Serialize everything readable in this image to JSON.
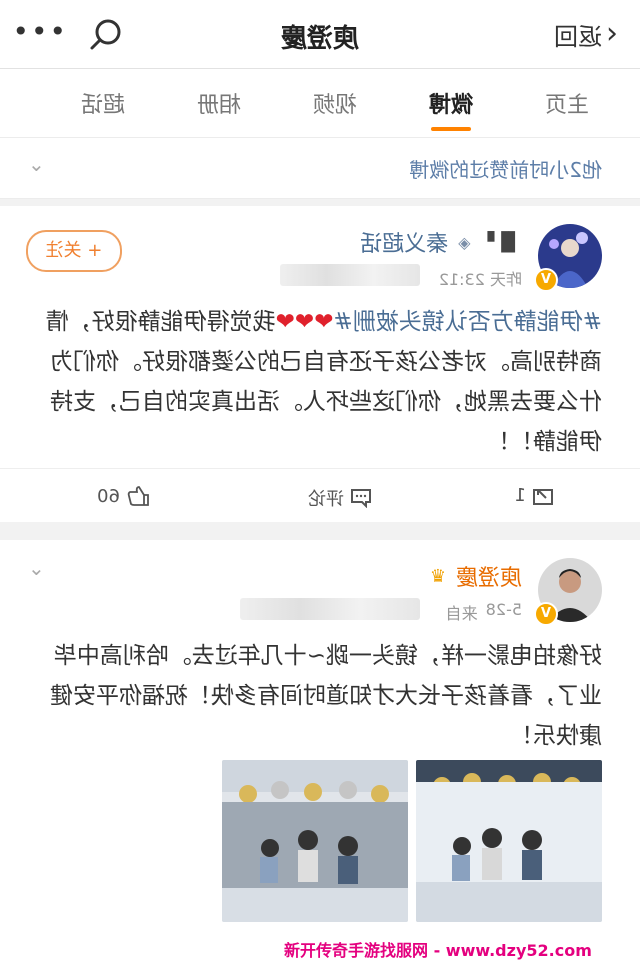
{
  "header": {
    "back_label": "返回",
    "title": "庾澄慶"
  },
  "tabs": [
    "主页",
    "微博",
    "视频",
    "相册",
    "超话"
  ],
  "active_tab": "微博",
  "liked_header": "他2小时前赞过的微博",
  "post1": {
    "username": "秦义超话",
    "timestamp": "昨天 23:12",
    "follow_label": "+ 关注",
    "topic": "#伊能静方否认镜头被删#",
    "hearts": "❤❤❤",
    "text": "我觉得伊能静很好，情商特别高。对老公孩子还有自己的公婆都很好。你们为什么要去黑她，你们这些坏人。活出真实的自己，支持伊能静！！",
    "repost_count": "1",
    "comment_label": "评论",
    "like_count": "60"
  },
  "post2": {
    "username": "庾澄慶",
    "timestamp": "5-28",
    "source_prefix": "来自",
    "text": "好像拍电影一样，镜头一跳~十几年过去。哈利高中毕业了，看着孩子长大才知道时间有多快！祝福你平安健康快乐！"
  },
  "watermark": "新开传奇手游找服网 - www.dzy52.com",
  "colors": {
    "accent": "#ff8200",
    "link": "#4a6d94",
    "heart": "#e0212c",
    "watermark": "#e4007f"
  },
  "icons": [
    "chevron-left-icon",
    "search-icon",
    "more-icon",
    "chevron-down-icon",
    "repost-icon",
    "comment-icon",
    "like-icon",
    "verified-badge-icon",
    "crown-icon"
  ]
}
